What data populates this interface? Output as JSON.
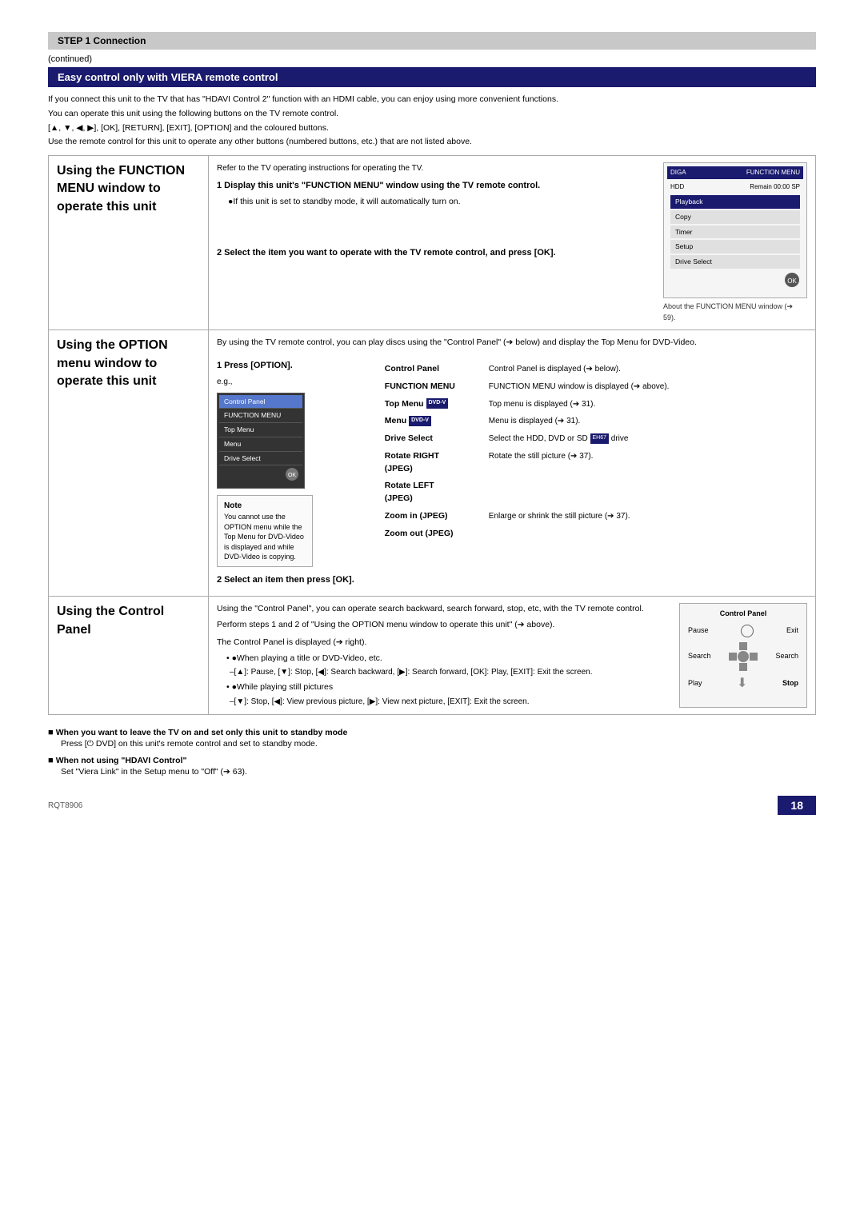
{
  "header": {
    "step": "STEP 1  Connection"
  },
  "continued": "(continued)",
  "section_title": "Easy control only with VIERA remote control",
  "intro": {
    "line1": "If you connect this unit to the TV that has \"HDAVI Control 2\" function with an HDMI cable, you can enjoy using more convenient functions.",
    "line2": "You can operate this unit using the following buttons on the TV remote control.",
    "line3": "[▲, ▼, ◀, ▶], [OK], [RETURN], [EXIT], [OPTION] and the coloured buttons.",
    "line4": "Use the remote control for this unit to operate any other buttons (numbered buttons, etc.) that are not listed above."
  },
  "section1": {
    "left_label": "Using the FUNCTION MENU window to operate this unit",
    "refer_note": "Refer to the TV operating instructions for operating the TV.",
    "step1": "1  Display this unit's \"FUNCTION MENU\" window using the TV remote control.",
    "step1_sub": "●If this unit is set to standby mode, it will automatically turn on.",
    "step2": "2  Select the item you want to operate with the TV remote control, and press [OK].",
    "function_menu": {
      "header_left": "DIGA",
      "header_right": "FUNCTION MENU",
      "hdd_label": "HDD",
      "remain_label": "Remain  00:00 SP",
      "items": [
        "Playback",
        "Copy",
        "Timer",
        "Setup",
        "Drive Select"
      ]
    },
    "caption": "About the FUNCTION MENU window (➔ 59)."
  },
  "section2": {
    "left_label": "Using the OPTION menu window to operate this unit",
    "intro": "By using the TV remote control, you can play discs using the \"Control Panel\" (➔ below) and display the Top Menu for DVD-Video.",
    "step1": "1  Press [OPTION].",
    "eg": "e.g.,",
    "menu_items": [
      "Control Panel",
      "FUNCTION MENU",
      "Top Menu",
      "Menu",
      "Drive Select"
    ],
    "note_label": "Note",
    "note_text": "You cannot use the OPTION menu while the Top Menu for DVD-Video is displayed and while DVD-Video is copying.",
    "step2": "2  Select an item then press [OK].",
    "option_table": [
      {
        "key": "Control Panel",
        "val": "Control Panel is displayed (➔ below)."
      },
      {
        "key": "FUNCTION MENU",
        "val": "FUNCTION MENU window is displayed (➔ above)."
      },
      {
        "key": "Top Menu DVD-V",
        "val": "Top menu is displayed (➔ 31)."
      },
      {
        "key": "Menu DVD-V",
        "val": "Menu is displayed (➔ 31)."
      },
      {
        "key": "Drive Select",
        "val": "Select the HDD, DVD or SD [EH67] drive"
      },
      {
        "key": "Rotate RIGHT (JPEG)",
        "val": "Rotate the still picture (➔ 37)."
      },
      {
        "key": "Rotate LEFT (JPEG)",
        "val": ""
      },
      {
        "key": "Zoom in (JPEG)",
        "val": "Enlarge or shrink the still picture (➔ 37)."
      },
      {
        "key": "Zoom out (JPEG)",
        "val": ""
      }
    ]
  },
  "section3": {
    "left_label": "Using the Control Panel",
    "intro1": "Using the \"Control Panel\", you can operate search backward, search forward, stop, etc, with the TV remote control.",
    "intro2": "Perform steps 1 and 2 of \"Using the OPTION menu window to operate this unit\" (➔ above).",
    "display": "The Control Panel is displayed (➔ right).",
    "playing_title": "●When playing a title or DVD-Video, etc.",
    "playing_title_desc": "–[▲]: Pause, [▼]: Stop, [◀]: Search backward, [▶]: Search forward, [OK]: Play, [EXIT]: Exit the screen.",
    "playing_still": "●While playing still pictures",
    "playing_still_desc": "–[▼]: Stop, [◀]: View previous picture, [▶]: View next picture, [EXIT]: Exit the screen.",
    "cp_title": "Control Panel",
    "cp_items": [
      "Pause",
      "Exit",
      "Search",
      "Search",
      "Play",
      "Stop"
    ]
  },
  "footer": {
    "standby_heading": "■ When you want to leave the TV on and set only this unit to standby mode",
    "standby_text": "Press [⏻ DVD] on this unit's remote control and set to standby mode.",
    "hdavi_heading": "■ When not using \"HDAVI Control\"",
    "hdavi_text": "Set \"Viera Link\" in the Setup menu to \"Off\" (➔ 63)."
  },
  "page": {
    "model": "RQT8906",
    "number": "18"
  }
}
